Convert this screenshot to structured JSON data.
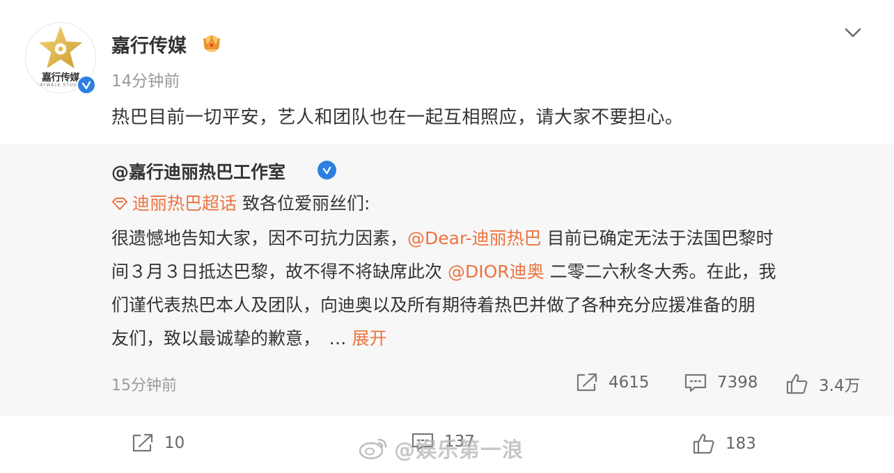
{
  "post": {
    "author": "嘉行传媒",
    "avatar_text": "嘉行传媒",
    "avatar_subtext": "JAYWALK STUDIO",
    "time": "14分钟前",
    "content": "热巴目前一切平安，艺人和团队也在一起互相照应，请大家不要担心。",
    "icons": [
      "avatar-logo",
      "verified-badge",
      "crown-badge",
      "chevron-down-icon"
    ]
  },
  "repost": {
    "author": "@嘉行迪丽热巴工作室",
    "topic": "迪丽热巴超话",
    "greeting": " 致各位爱丽丝们:",
    "body": {
      "l1a": "很遗憾地告知大家，因不可抗力因素，",
      "l1_mention": "@Dear-迪丽热巴",
      "l1b": " 目前已确定无法于法国巴黎时",
      "l2a": "间３月３日抵达巴黎，故不得不将缺席此次 ",
      "l2_mention": "@DIOR迪奥",
      "l2b": " 二零二六秋冬大秀。在此，我",
      "l3": "们谨代表热巴本人及团队，向迪奥以及所有期待着热巴并做了各种充分应援准备的朋",
      "l4": "友们，致以最诚挚的歉意，　… ",
      "expand": "展开"
    },
    "time": "15分钟前",
    "stats": {
      "share": "4615",
      "comment": "7398",
      "like": "3.4万"
    }
  },
  "bottom": {
    "share": "10",
    "comment": "137",
    "like": "183"
  },
  "watermark": "@娱乐第一浪",
  "colors": {
    "link": "#eb7340",
    "verified": "#2d7fe0",
    "muted": "#9a9a9a",
    "repost_bg": "#f7f7f7"
  }
}
